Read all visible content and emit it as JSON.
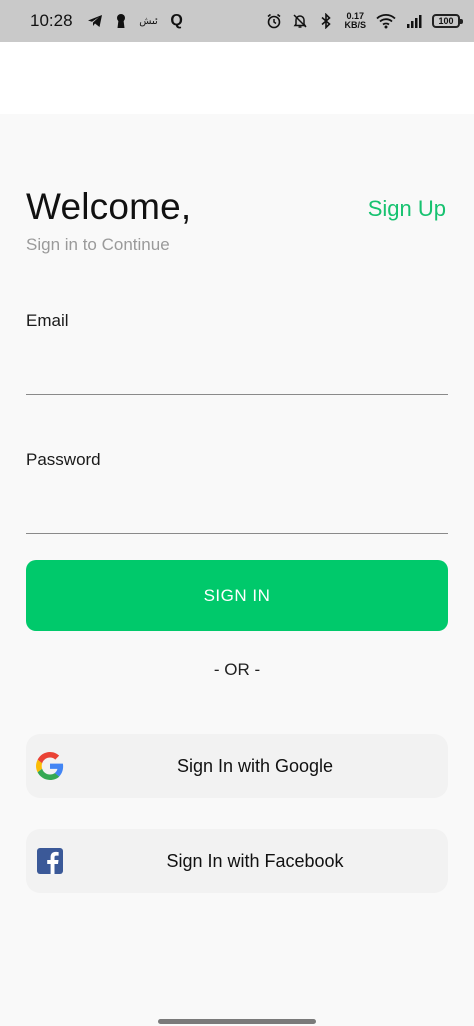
{
  "status_bar": {
    "time": "10:28",
    "left_icons": [
      "telegram-icon",
      "keyhole-icon",
      "app-icon",
      "q-icon"
    ],
    "app_glyph": "ئىش",
    "q_glyph": "Q",
    "net_speed_value": "0.17",
    "net_speed_unit": "KB/S",
    "battery": "100"
  },
  "header": {
    "title": "Welcome,",
    "subtitle": "Sign in to Continue",
    "signup_label": "Sign Up"
  },
  "form": {
    "email_label": "Email",
    "email_value": "",
    "password_label": "Password",
    "password_value": "",
    "signin_label": "SIGN IN"
  },
  "divider": {
    "or_text": "- OR -"
  },
  "social": {
    "google_label": "Sign In with Google",
    "facebook_label": "Sign In with Facebook",
    "facebook_glyph": "f"
  },
  "colors": {
    "accent": "#00c96b",
    "link": "#17c270",
    "facebook": "#3b5998"
  }
}
